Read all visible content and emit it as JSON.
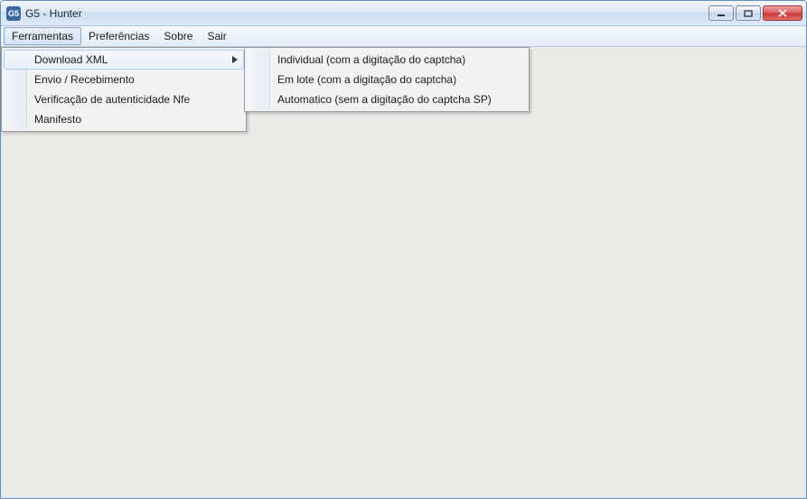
{
  "window": {
    "title": "G5 - Hunter",
    "icon_text": "G5"
  },
  "menubar": {
    "items": [
      {
        "label": "Ferramentas",
        "active": true
      },
      {
        "label": "Preferências",
        "active": false
      },
      {
        "label": "Sobre",
        "active": false
      },
      {
        "label": "Sair",
        "active": false
      }
    ]
  },
  "dropdown": {
    "items": [
      {
        "label": "Download XML",
        "has_submenu": true,
        "hovered": true
      },
      {
        "label": "Envio / Recebimento",
        "has_submenu": false,
        "hovered": false
      },
      {
        "label": "Verificação de autenticidade Nfe",
        "has_submenu": false,
        "hovered": false
      },
      {
        "label": "Manifesto",
        "has_submenu": false,
        "hovered": false
      }
    ]
  },
  "submenu": {
    "items": [
      {
        "label": "Individual (com a digitação do captcha)"
      },
      {
        "label": "Em lote (com a digitação do captcha)"
      },
      {
        "label": "Automatico (sem a digitação do captcha SP)"
      }
    ]
  }
}
